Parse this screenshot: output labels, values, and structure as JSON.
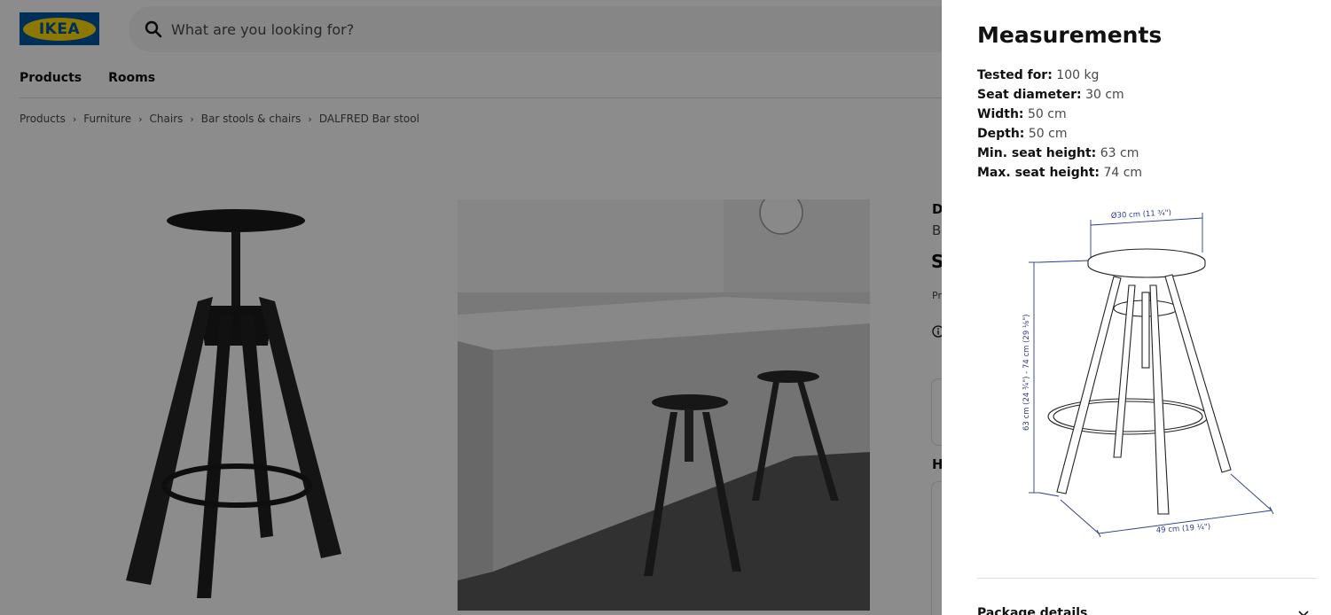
{
  "header": {
    "logo_text": "IKEA",
    "search_placeholder": "What are you looking for?"
  },
  "nav": {
    "items": [
      "Products",
      "Rooms"
    ]
  },
  "breadcrumb": [
    "Products",
    "Furniture",
    "Chairs",
    "Bar stools & chairs",
    "DALFRED Bar stool"
  ],
  "product_fragments": {
    "name_initial": "D",
    "desc_initial": "B",
    "price_initial": "S",
    "small_text": "Pr",
    "section_initial": "H"
  },
  "modal": {
    "title": "Measurements",
    "specs": [
      {
        "label": "Tested for:",
        "value": "100 kg"
      },
      {
        "label": "Seat diameter:",
        "value": "30 cm"
      },
      {
        "label": "Width:",
        "value": "50 cm"
      },
      {
        "label": "Depth:",
        "value": "50 cm"
      },
      {
        "label": "Min. seat height:",
        "value": "63 cm"
      },
      {
        "label": "Max. seat height:",
        "value": "74 cm"
      }
    ],
    "diagram_labels": {
      "seat": "Ø30 cm (11 ¾\")",
      "height": "63 cm (24 ¾\") - 74 cm (29 ⅛\")",
      "width": "49 cm (19 ¼\")"
    },
    "package_details_label": "Package details"
  },
  "colors": {
    "brand_blue": "#0058a3",
    "brand_yellow": "#ffdb00",
    "dimension_blue": "#2a3a8c"
  },
  "icons": {
    "search": "search-icon",
    "info": "info-icon",
    "chevron": "chevron-down-icon"
  }
}
